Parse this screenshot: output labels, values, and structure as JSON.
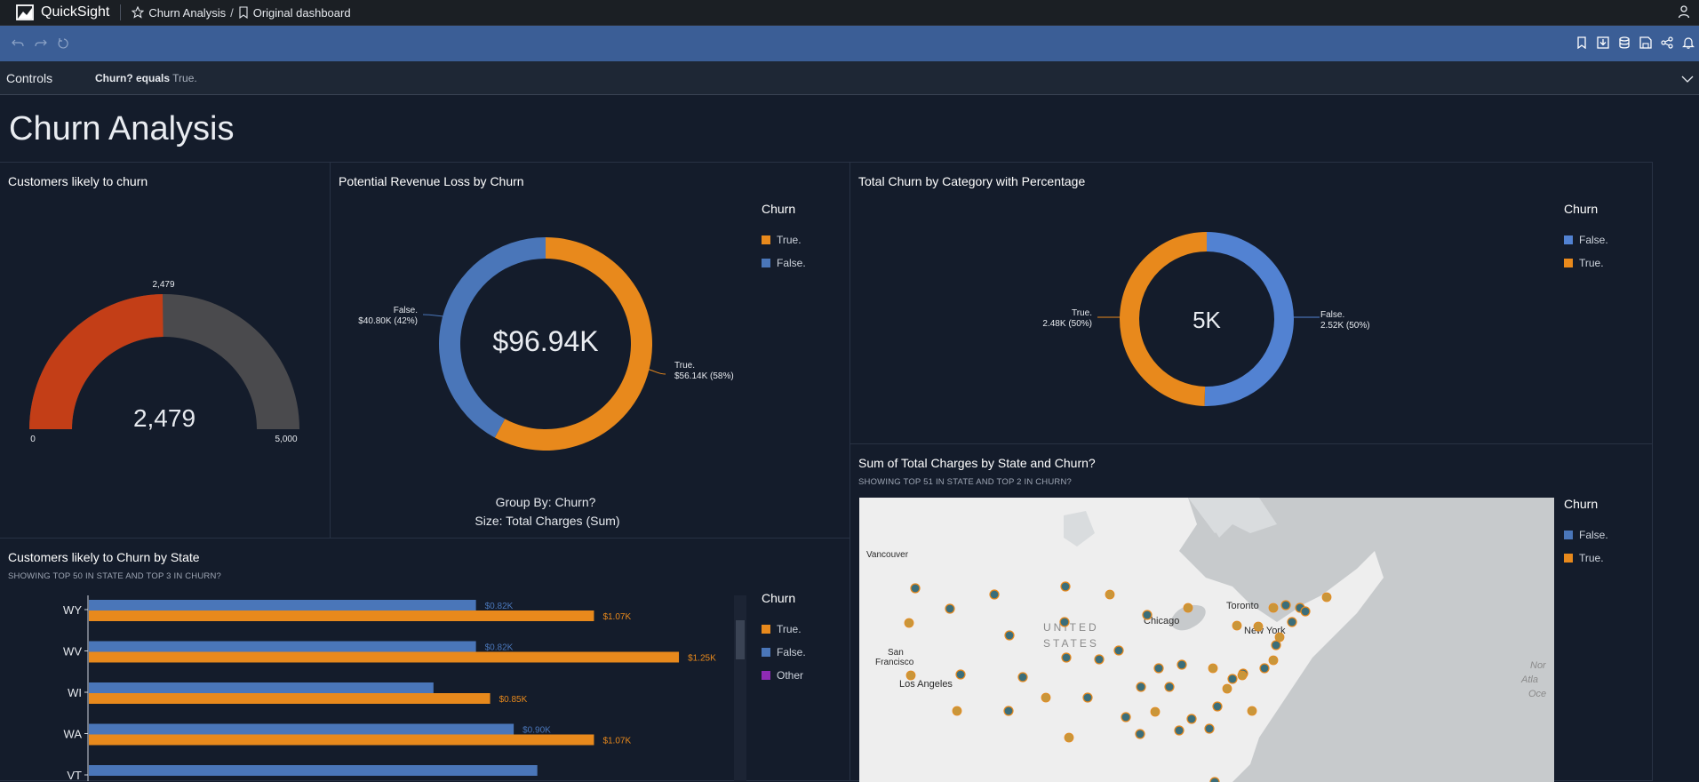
{
  "app": {
    "brand": "QuickSight",
    "breadcrumb": {
      "analysis": "Churn Analysis",
      "separator": "/",
      "dashboard": "Original dashboard"
    }
  },
  "toolbar": {
    "left_icons": [
      "undo-icon",
      "redo-icon",
      "reset-icon"
    ],
    "right_icons": [
      "bookmark-icon",
      "download-icon",
      "dataset-icon",
      "save-icon",
      "share-icon",
      "alert-icon"
    ]
  },
  "controls": {
    "label": "Controls",
    "filter_field": "Churn? equals",
    "filter_value": "True."
  },
  "dashboard": {
    "title": "Churn Analysis"
  },
  "colors": {
    "true": "#e8891c",
    "false": "#4a76b9",
    "false_donut": "#5282d2",
    "gauge_fill": "#c33e17",
    "gauge_track": "#4a4a4d",
    "other": "#8f2bb5"
  },
  "gauge": {
    "title": "Customers likely to churn",
    "value": 2479,
    "value_label": "2,479",
    "top_label": "2,479",
    "min_label": "0",
    "max_label": "5,000",
    "min": 0,
    "max": 5000
  },
  "revenue": {
    "title": "Potential Revenue Loss by Churn",
    "center_label": "$96.94K",
    "legend_title": "Churn",
    "legend": [
      {
        "label": "True.",
        "color": "#e8891c"
      },
      {
        "label": "False.",
        "color": "#4a76b9"
      }
    ],
    "slices": [
      {
        "name": "True.",
        "value": 56.14,
        "percent": 58,
        "label_line1": "True.",
        "label_line2": "$56.14K (58%)"
      },
      {
        "name": "False.",
        "value": 40.8,
        "percent": 42,
        "label_line1": "False.",
        "label_line2": "$40.80K (42%)"
      }
    ],
    "footer_group": "Group By: Churn?",
    "footer_size": "Size: Total Charges (Sum)"
  },
  "category": {
    "title": "Total Churn by Category with Percentage",
    "center_label": "5K",
    "legend_title": "Churn",
    "legend": [
      {
        "label": "False.",
        "color": "#5282d2"
      },
      {
        "label": "True.",
        "color": "#e8891c"
      }
    ],
    "slices": [
      {
        "name": "False.",
        "value": 2.52,
        "percent": 50,
        "label_line1": "False.",
        "label_line2": "2.52K (50%)"
      },
      {
        "name": "True.",
        "value": 2.48,
        "percent": 50,
        "label_line1": "True.",
        "label_line2": "2.48K (50%)"
      }
    ]
  },
  "bars": {
    "title": "Customers likely to Churn by State",
    "subtitle": "SHOWING TOP 50 IN STATE AND TOP 3 IN CHURN?",
    "legend_title": "Churn",
    "legend": [
      {
        "label": "True.",
        "color": "#e8891c"
      },
      {
        "label": "False.",
        "color": "#4a76b9"
      },
      {
        "label": "Other",
        "color": "#8f2bb5"
      }
    ]
  },
  "chart_data": {
    "type": "bar",
    "orientation": "horizontal",
    "categories": [
      "WY",
      "WV",
      "WI",
      "WA",
      "VT"
    ],
    "series": [
      {
        "name": "False.",
        "values": [
          0.82,
          0.82,
          0.73,
          0.9,
          0.95
        ],
        "labels": [
          "$0.82K",
          "$0.82K",
          "",
          "$0.90K",
          ""
        ]
      },
      {
        "name": "True.",
        "values": [
          1.07,
          1.25,
          0.85,
          1.07,
          null
        ],
        "labels": [
          "$1.07K",
          "$1.25K",
          "$0.85K",
          "$1.07K",
          ""
        ]
      }
    ],
    "xlim": [
      0,
      1.28
    ]
  },
  "map": {
    "title": "Sum of Total Charges by State and Churn?",
    "subtitle": "SHOWING TOP 51 IN STATE AND TOP 2 IN CHURN?",
    "legend_title": "Churn",
    "legend": [
      {
        "label": "False.",
        "color": "#4a76b9"
      },
      {
        "label": "True.",
        "color": "#e8891c"
      }
    ],
    "places": {
      "vancouver": "Vancouver",
      "toronto": "Toronto",
      "chicago": "Chicago",
      "new_york": "New York",
      "san": "San",
      "francisco": "Francisco",
      "los_angeles": "Los Angeles",
      "united": "UNITED",
      "states": "STATES",
      "nor": "Nor",
      "atla": "Atla",
      "oce": "Oce"
    }
  }
}
